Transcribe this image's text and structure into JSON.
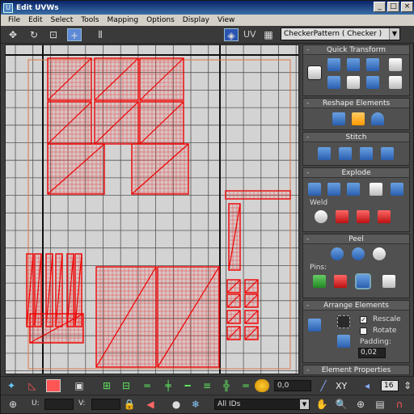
{
  "window": {
    "title": "Edit UVWs",
    "controls": [
      "_",
      "□",
      "×"
    ]
  },
  "menu": [
    "File",
    "Edit",
    "Select",
    "Tools",
    "Mapping",
    "Options",
    "Display",
    "View"
  ],
  "toolbar": {
    "uv_label": "UV",
    "texture_select": "CheckerPattern  ( Checker )",
    "icons": [
      "move-icon",
      "rotate-icon",
      "scale-icon",
      "freeform-icon",
      "mirror-icon"
    ]
  },
  "panel": {
    "quick_transform": {
      "title": "Quick Transform"
    },
    "reshape": {
      "title": "Reshape Elements"
    },
    "stitch": {
      "title": "Stitch"
    },
    "explode": {
      "title": "Explode",
      "weld_label": "Weld"
    },
    "peel": {
      "title": "Peel",
      "pins_label": "Pins:"
    },
    "arrange": {
      "title": "Arrange Elements",
      "rescale_label": "Rescale",
      "rescale_checked": true,
      "rotate_label": "Rotate",
      "rotate_checked": false,
      "padding_label": "Padding:",
      "padding_value": "0,02"
    },
    "element_properties": {
      "title": "Element Properties"
    }
  },
  "bottom": {
    "value_field": "0,0",
    "xy_label": "XY",
    "grid_value": "16",
    "u_label": "U:",
    "v_label": "V:",
    "ids_select": "All IDs"
  }
}
